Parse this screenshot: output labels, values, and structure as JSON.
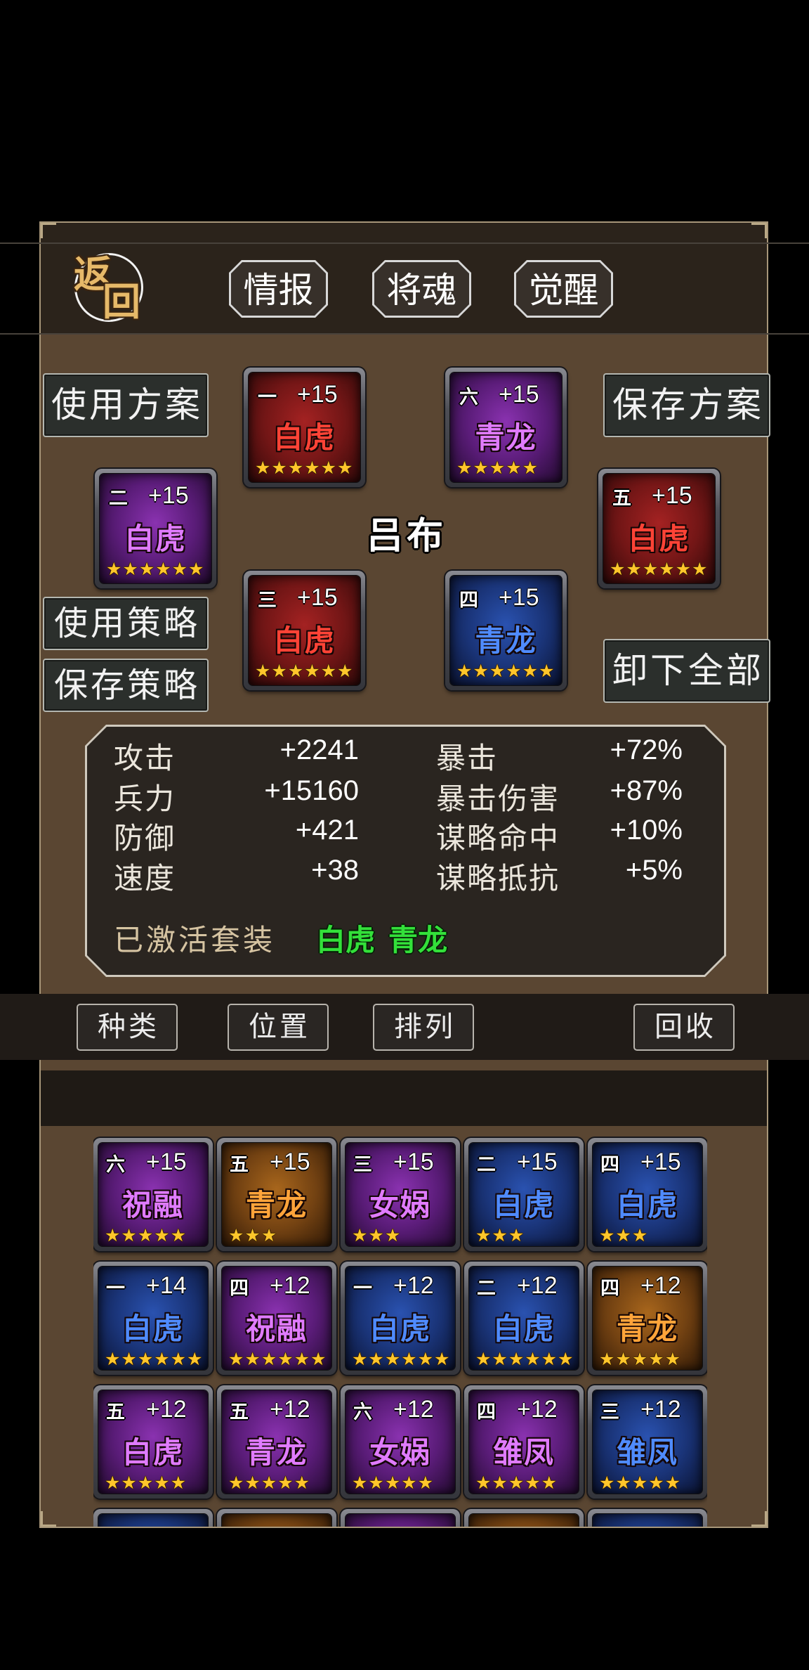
{
  "header": {
    "back": {
      "top_char": "返",
      "bottom_char": "回"
    },
    "tabs": [
      {
        "label": "情报"
      },
      {
        "label": "将魂"
      },
      {
        "label": "觉醒"
      }
    ]
  },
  "actions": {
    "use_plan": "使用方案",
    "save_plan": "保存方案",
    "use_strategy": "使用策略",
    "save_strategy": "保存策略",
    "unequip_all": "卸下全部"
  },
  "hero": {
    "name": "吕布"
  },
  "equipped": [
    {
      "slot": "一",
      "level": "+15",
      "name": "白虎",
      "stars": 6,
      "color": "red"
    },
    {
      "slot": "二",
      "level": "+15",
      "name": "白虎",
      "stars": 6,
      "color": "purple"
    },
    {
      "slot": "三",
      "level": "+15",
      "name": "白虎",
      "stars": 6,
      "color": "red"
    },
    {
      "slot": "四",
      "level": "+15",
      "name": "青龙",
      "stars": 6,
      "color": "blue"
    },
    {
      "slot": "五",
      "level": "+15",
      "name": "白虎",
      "stars": 6,
      "color": "red"
    },
    {
      "slot": "六",
      "level": "+15",
      "name": "青龙",
      "stars": 5,
      "color": "purple"
    }
  ],
  "stats": {
    "left": [
      {
        "label": "攻击",
        "value": "+2241"
      },
      {
        "label": "兵力",
        "value": "+15160"
      },
      {
        "label": "防御",
        "value": "+421"
      },
      {
        "label": "速度",
        "value": "+38"
      }
    ],
    "right": [
      {
        "label": "暴击",
        "value": "+72%"
      },
      {
        "label": "暴击伤害",
        "value": "+87%"
      },
      {
        "label": "谋略命中",
        "value": "+10%"
      },
      {
        "label": "谋略抵抗",
        "value": "+5%"
      }
    ],
    "set_label": "已激活套装",
    "active_sets": [
      "白虎",
      "青龙"
    ]
  },
  "toolbar": {
    "category": "种类",
    "slot": "位置",
    "sort": "排列",
    "recycle": "回收"
  },
  "inventory": [
    {
      "slot": "六",
      "level": "+15",
      "name": "祝融",
      "stars": 5,
      "color": "purple"
    },
    {
      "slot": "五",
      "level": "+15",
      "name": "青龙",
      "stars": 3,
      "color": "orange"
    },
    {
      "slot": "三",
      "level": "+15",
      "name": "女娲",
      "stars": 3,
      "color": "purple"
    },
    {
      "slot": "二",
      "level": "+15",
      "name": "白虎",
      "stars": 3,
      "color": "blue"
    },
    {
      "slot": "四",
      "level": "+15",
      "name": "白虎",
      "stars": 3,
      "color": "blue"
    },
    {
      "slot": "一",
      "level": "+14",
      "name": "白虎",
      "stars": 6,
      "color": "blue"
    },
    {
      "slot": "四",
      "level": "+12",
      "name": "祝融",
      "stars": 6,
      "color": "purple"
    },
    {
      "slot": "一",
      "level": "+12",
      "name": "白虎",
      "stars": 6,
      "color": "blue"
    },
    {
      "slot": "二",
      "level": "+12",
      "name": "白虎",
      "stars": 6,
      "color": "blue"
    },
    {
      "slot": "四",
      "level": "+12",
      "name": "青龙",
      "stars": 5,
      "color": "orange"
    },
    {
      "slot": "五",
      "level": "+12",
      "name": "白虎",
      "stars": 5,
      "color": "purple"
    },
    {
      "slot": "五",
      "level": "+12",
      "name": "青龙",
      "stars": 5,
      "color": "purple"
    },
    {
      "slot": "六",
      "level": "+12",
      "name": "女娲",
      "stars": 5,
      "color": "purple"
    },
    {
      "slot": "四",
      "level": "+12",
      "name": "雏凤",
      "stars": 5,
      "color": "purple"
    },
    {
      "slot": "三",
      "level": "+12",
      "name": "雏凤",
      "stars": 5,
      "color": "blue"
    }
  ],
  "inventory_partial": [
    {
      "color": "blue"
    },
    {
      "color": "orange"
    },
    {
      "color": "purple"
    },
    {
      "color": "orange"
    },
    {
      "color": "blue"
    }
  ],
  "rarity_colors": {
    "red": "#ff4336",
    "purple": "#e07bff",
    "blue": "#4f8bff",
    "orange": "#ffa43a"
  },
  "set_active_color": "#33e03a",
  "star_color": "#ffc62b"
}
